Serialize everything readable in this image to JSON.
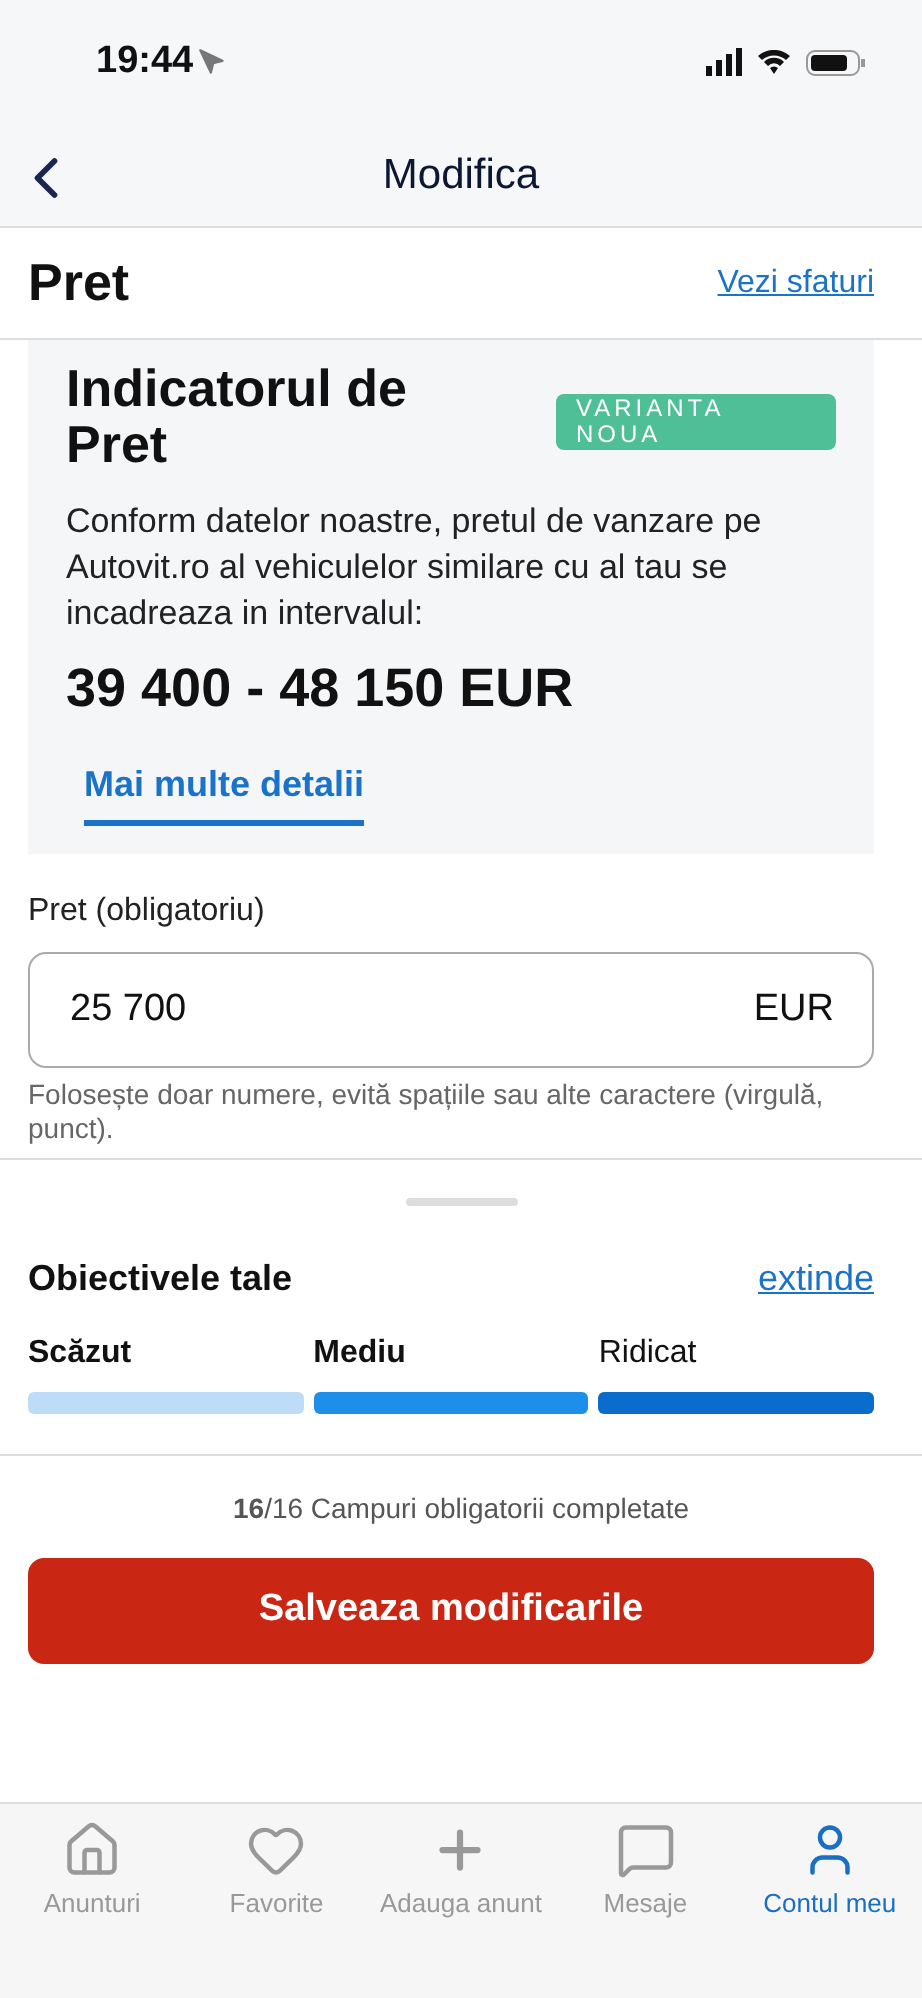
{
  "status_bar": {
    "time": "19:44"
  },
  "nav": {
    "title": "Modifica"
  },
  "section": {
    "title": "Pret",
    "link": "Vezi sfaturi"
  },
  "indicator": {
    "title": "Indicatorul de Pret",
    "badge": "VARIANTA NOUA",
    "text": "Conform datelor noastre, pretul de vanzare pe Autovit.ro al vehiculelor similare cu al tau se incadreaza in intervalul:",
    "range": "39 400 - 48 150 EUR",
    "tab": {
      "label": "Mai multe detalii",
      "selected": true
    }
  },
  "price_field": {
    "label": "Pret (obligatoriu)",
    "value": "25 700",
    "unit": "EUR",
    "hint": "Folosește doar numere, evită spațiile sau alte caractere (virgulă, punct)."
  },
  "objectives": {
    "title": "Obiectivele tale",
    "link": "extinde",
    "levels": [
      {
        "label": "Scăzut",
        "reached": true,
        "color": "#bcdcf7"
      },
      {
        "label": "Mediu",
        "reached": true,
        "color": "#1e8fe8"
      },
      {
        "label": "Ridicat",
        "reached": false,
        "color": "#0a6ccc"
      }
    ]
  },
  "progress": "**16**/16 Campuri obligatorii completate",
  "save_button": "Salveaza modificarile",
  "tab_bar": [
    {
      "label": "Anunturi",
      "selected": false
    },
    {
      "label": "Favorite",
      "selected": false
    },
    {
      "label": "Adauga anunt",
      "selected": false
    },
    {
      "label": "Mesaje",
      "selected": false
    },
    {
      "label": "Contul meu",
      "selected": true
    }
  ]
}
